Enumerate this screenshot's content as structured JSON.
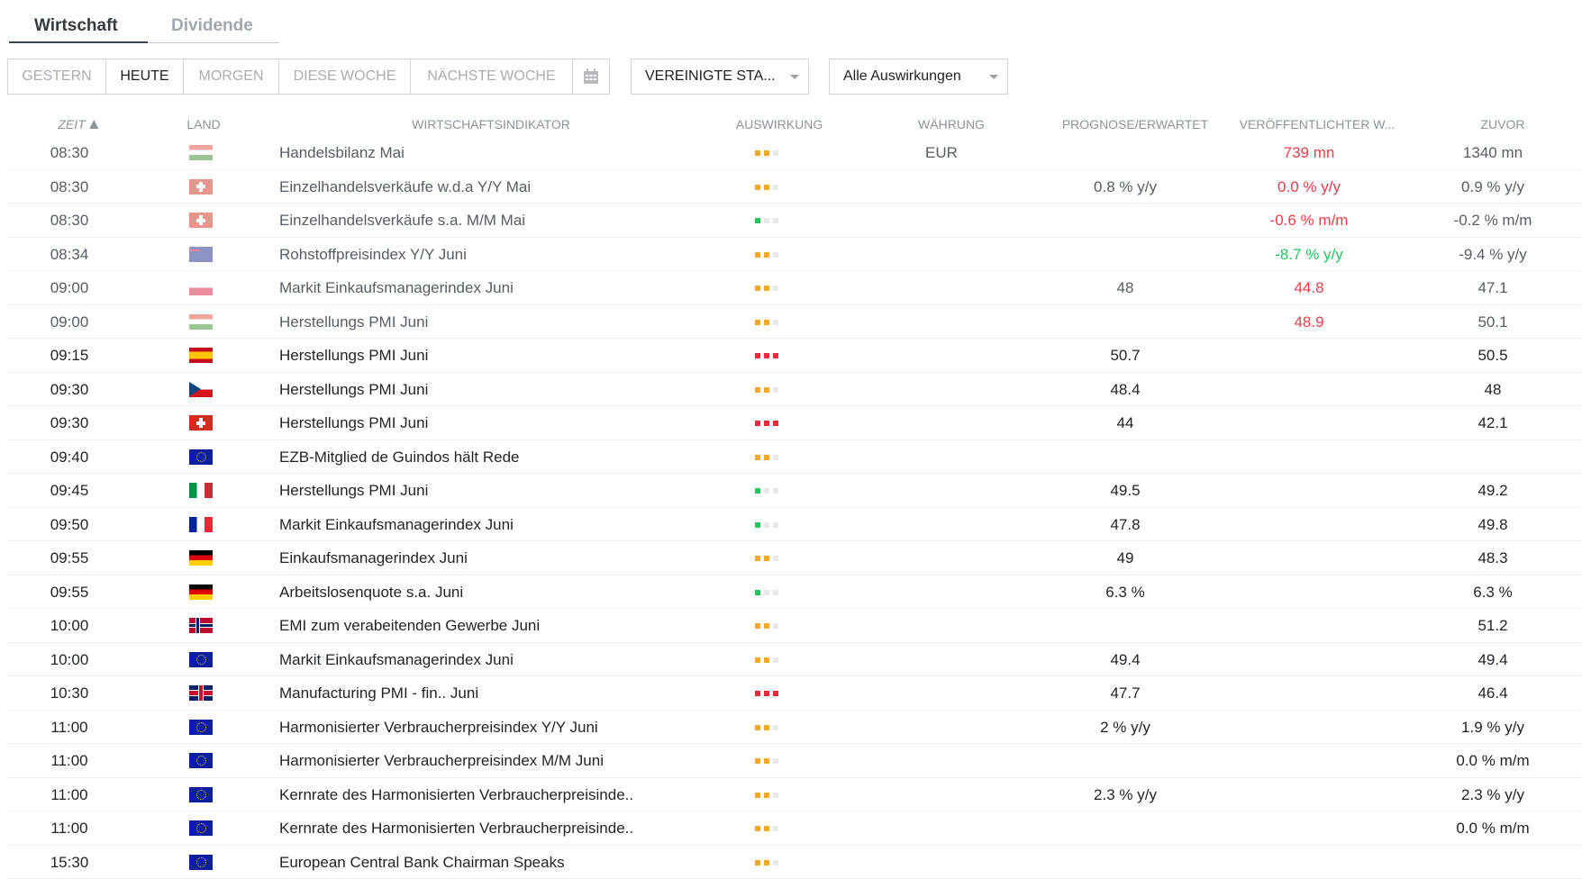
{
  "tabs": [
    {
      "label": "Wirtschaft",
      "active": true
    },
    {
      "label": "Dividende",
      "active": false
    }
  ],
  "date_filters": [
    {
      "label": "GESTERN",
      "active": false
    },
    {
      "label": "HEUTE",
      "active": true
    },
    {
      "label": "MORGEN",
      "active": false
    },
    {
      "label": "DIESE WOCHE",
      "active": false
    },
    {
      "label": "NÄCHSTE WOCHE",
      "active": false
    }
  ],
  "calendar_icon": "calendar-icon",
  "country_dropdown": "VEREINIGTE STA...",
  "impact_dropdown": "Alle Auswirkungen",
  "columns": {
    "time": "ZEIT",
    "country": "LAND",
    "indicator": "WIRTSCHAFTSINDIKATOR",
    "impact": "AUSWIRKUNG",
    "currency": "WÄHRUNG",
    "forecast": "PROGNOSE/ERWARTET",
    "actual": "VERÖFFENTLICHTER W...",
    "previous": "ZUVOR"
  },
  "impact_colors": {
    "1": "#1ec75b",
    "2": "#f5a623",
    "3": "#f0283c"
  },
  "rows": [
    {
      "time": "08:30",
      "flag": "hu",
      "indicator": "Handelsbilanz Mai",
      "impact": 2,
      "currency": "EUR",
      "forecast": "",
      "actual": "739 mn",
      "actual_color": "red",
      "previous": "1340 mn",
      "past": true
    },
    {
      "time": "08:30",
      "flag": "ch",
      "indicator": "Einzelhandelsverkäufe w.d.a Y/Y Mai",
      "impact": 2,
      "currency": "",
      "forecast": "0.8 % y/y",
      "actual": "0.0 % y/y",
      "actual_color": "red",
      "previous": "0.9 % y/y",
      "past": true
    },
    {
      "time": "08:30",
      "flag": "ch",
      "indicator": "Einzelhandelsverkäufe s.a. M/M Mai",
      "impact": 1,
      "currency": "",
      "forecast": "",
      "actual": "-0.6 % m/m",
      "actual_color": "red",
      "previous": "-0.2 % m/m",
      "past": true
    },
    {
      "time": "08:34",
      "flag": "au",
      "indicator": "Rohstoffpreisindex Y/Y Juni",
      "impact": 2,
      "currency": "",
      "forecast": "",
      "actual": "-8.7 % y/y",
      "actual_color": "green",
      "previous": "-9.4 % y/y",
      "past": true
    },
    {
      "time": "09:00",
      "flag": "pl",
      "indicator": "Markit Einkaufsmanagerindex Juni",
      "impact": 2,
      "currency": "",
      "forecast": "48",
      "actual": "44.8",
      "actual_color": "red",
      "previous": "47.1",
      "past": true
    },
    {
      "time": "09:00",
      "flag": "hu",
      "indicator": "Herstellungs PMI Juni",
      "impact": 2,
      "currency": "",
      "forecast": "",
      "actual": "48.9",
      "actual_color": "red",
      "previous": "50.1",
      "past": true
    },
    {
      "time": "09:15",
      "flag": "es",
      "indicator": "Herstellungs PMI Juni",
      "impact": 3,
      "currency": "",
      "forecast": "50.7",
      "actual": "",
      "actual_color": "",
      "previous": "50.5",
      "past": false
    },
    {
      "time": "09:30",
      "flag": "cz",
      "indicator": "Herstellungs PMI Juni",
      "impact": 2,
      "currency": "",
      "forecast": "48.4",
      "actual": "",
      "actual_color": "",
      "previous": "48",
      "past": false
    },
    {
      "time": "09:30",
      "flag": "ch",
      "indicator": "Herstellungs PMI Juni",
      "impact": 3,
      "currency": "",
      "forecast": "44",
      "actual": "",
      "actual_color": "",
      "previous": "42.1",
      "past": false
    },
    {
      "time": "09:40",
      "flag": "eu",
      "indicator": "EZB-Mitglied de Guindos hält Rede",
      "impact": 2,
      "currency": "",
      "forecast": "",
      "actual": "",
      "actual_color": "",
      "previous": "",
      "past": false
    },
    {
      "time": "09:45",
      "flag": "it",
      "indicator": "Herstellungs PMI Juni",
      "impact": 1,
      "currency": "",
      "forecast": "49.5",
      "actual": "",
      "actual_color": "",
      "previous": "49.2",
      "past": false
    },
    {
      "time": "09:50",
      "flag": "fr",
      "indicator": "Markit Einkaufsmanagerindex Juni",
      "impact": 1,
      "currency": "",
      "forecast": "47.8",
      "actual": "",
      "actual_color": "",
      "previous": "49.8",
      "past": false
    },
    {
      "time": "09:55",
      "flag": "de",
      "indicator": "Einkaufsmanagerindex Juni",
      "impact": 2,
      "currency": "",
      "forecast": "49",
      "actual": "",
      "actual_color": "",
      "previous": "48.3",
      "past": false
    },
    {
      "time": "09:55",
      "flag": "de",
      "indicator": "Arbeitslosenquote s.a. Juni",
      "impact": 1,
      "currency": "",
      "forecast": "6.3 %",
      "actual": "",
      "actual_color": "",
      "previous": "6.3 %",
      "past": false
    },
    {
      "time": "10:00",
      "flag": "no",
      "indicator": "EMI zum verabeitenden Gewerbe Juni",
      "impact": 2,
      "currency": "",
      "forecast": "",
      "actual": "",
      "actual_color": "",
      "previous": "51.2",
      "past": false
    },
    {
      "time": "10:00",
      "flag": "eu",
      "indicator": "Markit Einkaufsmanagerindex Juni",
      "impact": 2,
      "currency": "",
      "forecast": "49.4",
      "actual": "",
      "actual_color": "",
      "previous": "49.4",
      "past": false
    },
    {
      "time": "10:30",
      "flag": "gb",
      "indicator": "Manufacturing PMI - fin.. Juni",
      "impact": 3,
      "currency": "",
      "forecast": "47.7",
      "actual": "",
      "actual_color": "",
      "previous": "46.4",
      "past": false
    },
    {
      "time": "11:00",
      "flag": "eu",
      "indicator": "Harmonisierter Verbraucherpreisindex Y/Y Juni",
      "impact": 2,
      "currency": "",
      "forecast": "2 % y/y",
      "actual": "",
      "actual_color": "",
      "previous": "1.9 % y/y",
      "past": false
    },
    {
      "time": "11:00",
      "flag": "eu",
      "indicator": "Harmonisierter Verbraucherpreisindex M/M Juni",
      "impact": 2,
      "currency": "",
      "forecast": "",
      "actual": "",
      "actual_color": "",
      "previous": "0.0 % m/m",
      "past": false
    },
    {
      "time": "11:00",
      "flag": "eu",
      "indicator": "Kernrate des Harmonisierten Verbraucherpreisinde..",
      "impact": 2,
      "currency": "",
      "forecast": "2.3 % y/y",
      "actual": "",
      "actual_color": "",
      "previous": "2.3 % y/y",
      "past": false
    },
    {
      "time": "11:00",
      "flag": "eu",
      "indicator": "Kernrate des Harmonisierten Verbraucherpreisinde..",
      "impact": 2,
      "currency": "",
      "forecast": "",
      "actual": "",
      "actual_color": "",
      "previous": "0.0 % m/m",
      "past": false
    },
    {
      "time": "15:30",
      "flag": "eu",
      "indicator": "European Central Bank Chairman Speaks",
      "impact": 2,
      "currency": "",
      "forecast": "",
      "actual": "",
      "actual_color": "",
      "previous": "",
      "past": false
    }
  ]
}
